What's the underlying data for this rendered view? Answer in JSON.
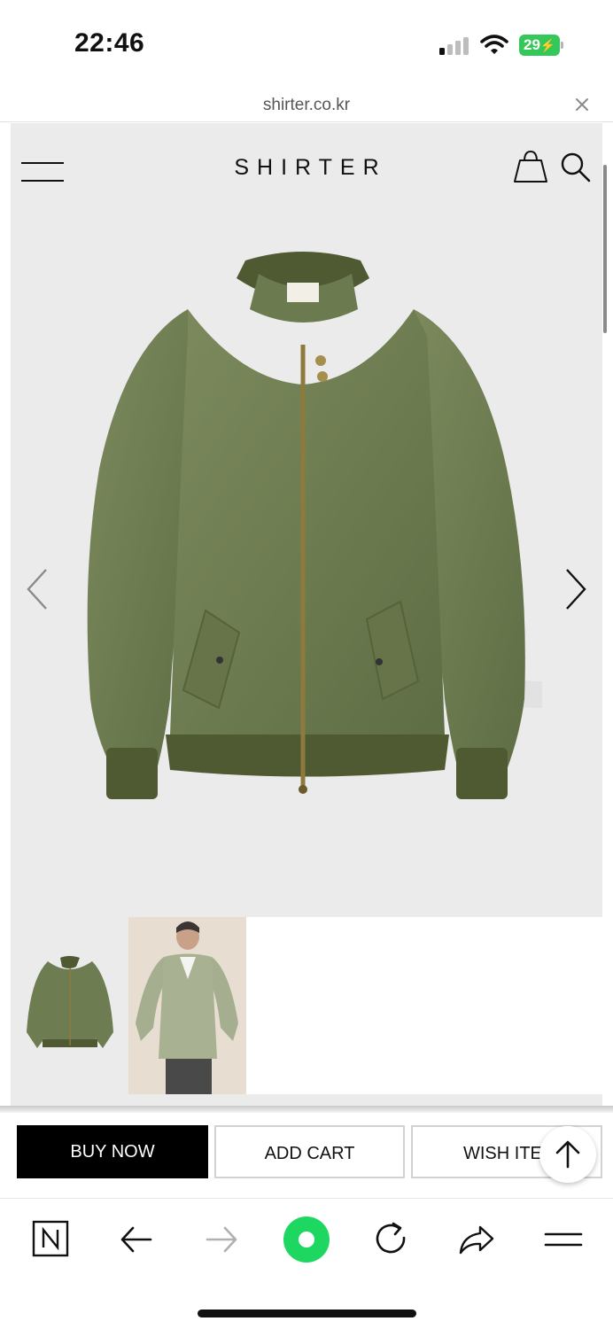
{
  "status_bar": {
    "time": "22:46",
    "battery_level": "29",
    "icons": [
      "signal-icon",
      "wifi-icon",
      "battery-charging-icon"
    ]
  },
  "browser": {
    "url": "shirter.co.kr",
    "close_icon": "close-icon"
  },
  "site_header": {
    "logo": "SHIRTER",
    "icons": [
      "hamburger-menu-icon",
      "shopping-bag-icon",
      "search-icon"
    ]
  },
  "product_gallery": {
    "main_image": "olive green bomber jacket",
    "prev_icon": "chevron-left-icon",
    "next_icon": "chevron-right-icon",
    "thumbnails": [
      "jacket product shot",
      "model wearing jacket"
    ]
  },
  "actions": {
    "buy_now": "BUY NOW",
    "add_cart": "ADD CART",
    "wish_item": "WISH ITEM",
    "scroll_top_icon": "arrow-up-icon"
  },
  "toolbar": {
    "icons": [
      "naver-n-icon",
      "back-arrow-icon",
      "forward-arrow-icon",
      "green-dot-home-icon",
      "reload-icon",
      "share-icon",
      "menu-icon"
    ]
  },
  "colors": {
    "jacket": "#6f7d52",
    "hero_bg": "#ebebeb",
    "battery": "#34c759",
    "home_button": "#1ed760"
  }
}
